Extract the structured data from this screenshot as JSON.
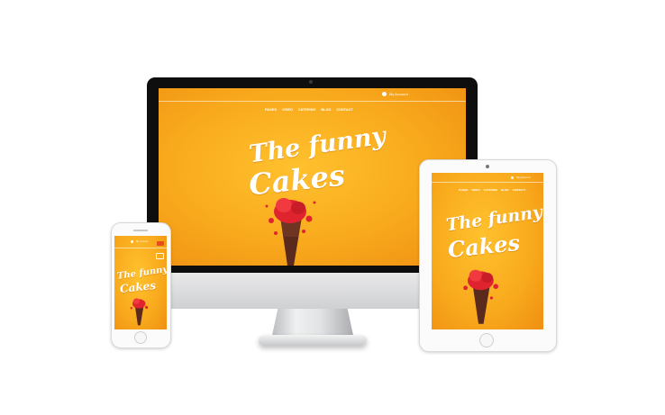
{
  "site": {
    "nav_items": [
      "PAGES",
      "VIDEO",
      "CATERING",
      "BLOG",
      "CONTACT"
    ],
    "account_label": "My Account",
    "brand_line1": "The funny",
    "brand_line2": "Cakes"
  },
  "colors": {
    "screen_orange": "#f8a91c",
    "cake_red": "#e0242f",
    "cone_brown": "#5a2a1c"
  },
  "icons": [
    "user-icon",
    "menu-icon",
    "cake-illustration"
  ]
}
